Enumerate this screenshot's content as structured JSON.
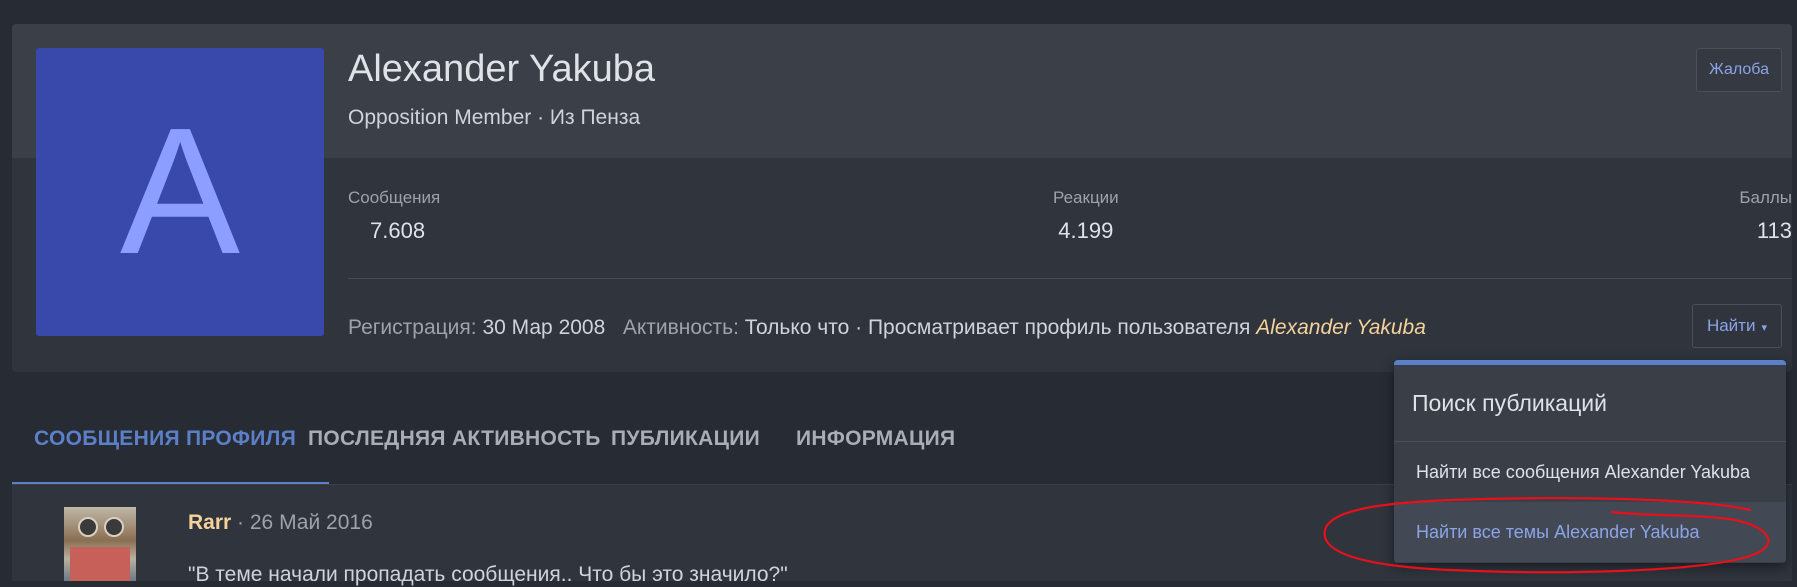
{
  "profile": {
    "avatar_letter": "A",
    "username": "Alexander Yakuba",
    "title_line": "Opposition Member · Из Пенза",
    "report_label": "Жалоба",
    "stats": [
      {
        "label": "Сообщения",
        "value": "7.608"
      },
      {
        "label": "Реакции",
        "value": "4.199"
      },
      {
        "label": "Баллы",
        "value": "113"
      }
    ],
    "registration_label": "Регистрация:",
    "registration_value": "30 Мар 2008",
    "activity_label": "Активность:",
    "activity_value": "Только что · Просматривает профиль пользователя",
    "activity_highlight": "Alexander Yakuba",
    "find_label": "Найти",
    "find_caret": "▾"
  },
  "tabs": [
    {
      "label": "СООБЩЕНИЯ ПРОФИЛЯ",
      "active": true
    },
    {
      "label": "ПОСЛЕДНЯЯ АКТИВНОСТЬ",
      "active": false
    },
    {
      "label": "ПУБЛИКАЦИИ",
      "active": false
    },
    {
      "label": "ИНФОРМАЦИЯ",
      "active": false
    }
  ],
  "post": {
    "author": "Rarr",
    "separator": " · ",
    "date": "26 Май 2016",
    "text": "\"В теме начали пропадать сообщения.. Что бы это значило?\""
  },
  "dropdown": {
    "title": "Поиск публикаций",
    "items": [
      {
        "label": "Найти все сообщения Alexander Yakuba"
      },
      {
        "label": "Найти все темы Alexander Yakuba"
      }
    ]
  },
  "colors": {
    "background": "#272c34",
    "card": "#2f343d",
    "accent": "#5c7fc9",
    "highlight_name": "#f5d29a",
    "avatar_bg": "#3949ab",
    "annotation": "#e8101a"
  }
}
